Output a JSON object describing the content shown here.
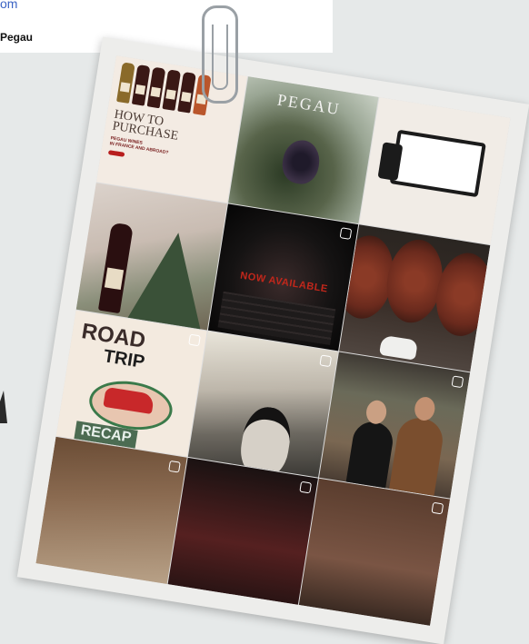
{
  "header_card": {
    "link_text": "om",
    "name_text": "Pegau"
  },
  "tiles": {
    "how_to": {
      "title": "HOW TO\nPURCHASE",
      "subtitle": "PEGAU WINES\nIN FRANCE AND ABROAD?"
    },
    "vineyard": {
      "brand": "PEGAU"
    },
    "now_available": {
      "text": "NOW AVAILABLE"
    },
    "road_trip": {
      "line1": "ROAD",
      "line2": "TRIP",
      "recap": "RECAP"
    }
  }
}
